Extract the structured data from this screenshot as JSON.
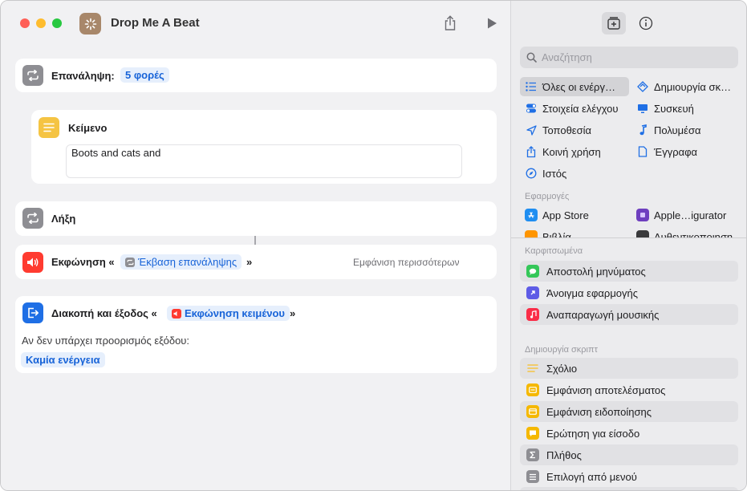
{
  "window": {
    "title": "Drop Me A Beat"
  },
  "editor": {
    "repeat": {
      "title": "Επανάληψη:",
      "token": "5 φορές"
    },
    "text": {
      "title": "Κείμενο",
      "value": "Boots and cats and"
    },
    "end": {
      "title": "Λήξη"
    },
    "speak": {
      "title": "Εκφώνηση «",
      "token": "Έκβαση επανάληψης",
      "close": "»",
      "more": "Εμφάνιση περισσότερων"
    },
    "stop": {
      "title": "Διακοπή και έξοδος «",
      "token": "Εκφώνηση κειμένου",
      "close": "»",
      "no_dest_label": "Αν δεν υπάρχει προορισμός εξόδου:",
      "no_dest_token": "Καμία ενέργεια"
    }
  },
  "library": {
    "search_placeholder": "Αναζήτηση",
    "categories": [
      {
        "label": "Όλες οι ενέργ…",
        "icon": "list-icon"
      },
      {
        "label": "Δημιουργία σκ…",
        "icon": "scripting-icon"
      },
      {
        "label": "Στοιχεία ελέγχου",
        "icon": "toggle-icon"
      },
      {
        "label": "Συσκευή",
        "icon": "monitor-icon"
      },
      {
        "label": "Τοποθεσία",
        "icon": "location-icon"
      },
      {
        "label": "Πολυμέσα",
        "icon": "music-note-icon"
      },
      {
        "label": "Κοινή χρήση",
        "icon": "share-icon"
      },
      {
        "label": "Έγγραφα",
        "icon": "document-icon"
      },
      {
        "label": "Ιστός",
        "icon": "compass-icon"
      }
    ],
    "apps_label": "Εφαρμογές",
    "apps": [
      {
        "label": "App Store",
        "icon": "app-store-icon"
      },
      {
        "label": "Apple…igurator",
        "icon": "configurator-icon"
      },
      {
        "label": "Βιβλία",
        "icon": "books-icon"
      },
      {
        "label": "Αυθεντικοποιηση",
        "icon": "authenticator-icon"
      }
    ],
    "pinned_label": "Καρφιτσωμένα",
    "pinned": [
      {
        "label": "Αποστολή μηνύματος",
        "icon": "messages-icon",
        "color": "#34c759"
      },
      {
        "label": "Άνοιγμα εφαρμογής",
        "icon": "open-app-icon",
        "color": "#5e5ce6"
      },
      {
        "label": "Αναπαραγωγή μουσικής",
        "icon": "music-icon",
        "color": "#fa2d48"
      }
    ],
    "scripting_label": "Δημιουργία σκριπτ",
    "scripting": [
      {
        "label": "Σχόλιο",
        "icon": "comment-lines-icon",
        "color": "#f5c443"
      },
      {
        "label": "Εμφάνιση αποτελέσματος",
        "icon": "show-result-icon",
        "color": "#f5b800"
      },
      {
        "label": "Εμφάνιση ειδοποίησης",
        "icon": "alert-icon",
        "color": "#f5b800"
      },
      {
        "label": "Ερώτηση για είσοδο",
        "icon": "ask-input-icon",
        "color": "#f5b800"
      },
      {
        "label": "Πλήθος",
        "icon": "sigma-icon",
        "color": "#8e8e93"
      },
      {
        "label": "Επιλογή από μενού",
        "icon": "menu-icon",
        "color": "#8e8e93"
      }
    ]
  }
}
